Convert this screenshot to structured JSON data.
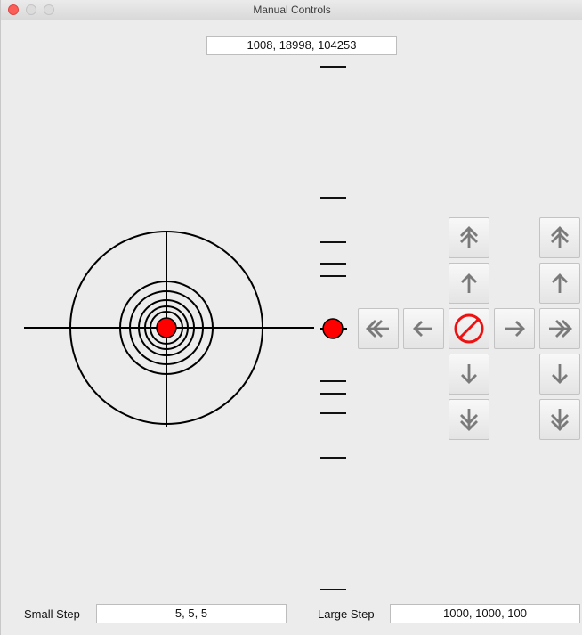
{
  "window": {
    "title": "Manual Controls"
  },
  "position_readout": "1008, 18998, 104253",
  "small_step": {
    "label": "Small Step",
    "value": "5, 5, 5"
  },
  "large_step": {
    "label": "Large Step",
    "value": "1000, 1000, 100"
  },
  "icons": {
    "xy_large_up": "double-arrow-up-icon",
    "xy_small_up": "arrow-up-icon",
    "xy_small_down": "arrow-down-icon",
    "xy_large_down": "double-arrow-down-icon",
    "x_large_left": "double-arrow-left-icon",
    "x_small_left": "arrow-left-icon",
    "stop": "stop-icon",
    "x_small_right": "arrow-right-icon",
    "x_large_right": "double-arrow-right-icon",
    "z_large_up": "double-arrow-up-icon",
    "z_small_up": "arrow-up-icon",
    "z_small_down": "arrow-down-icon",
    "z_large_down": "double-arrow-down-icon"
  },
  "colors": {
    "marker": "#ff0000",
    "stop": "#ee1111",
    "arrow": "#7a7a7a"
  }
}
